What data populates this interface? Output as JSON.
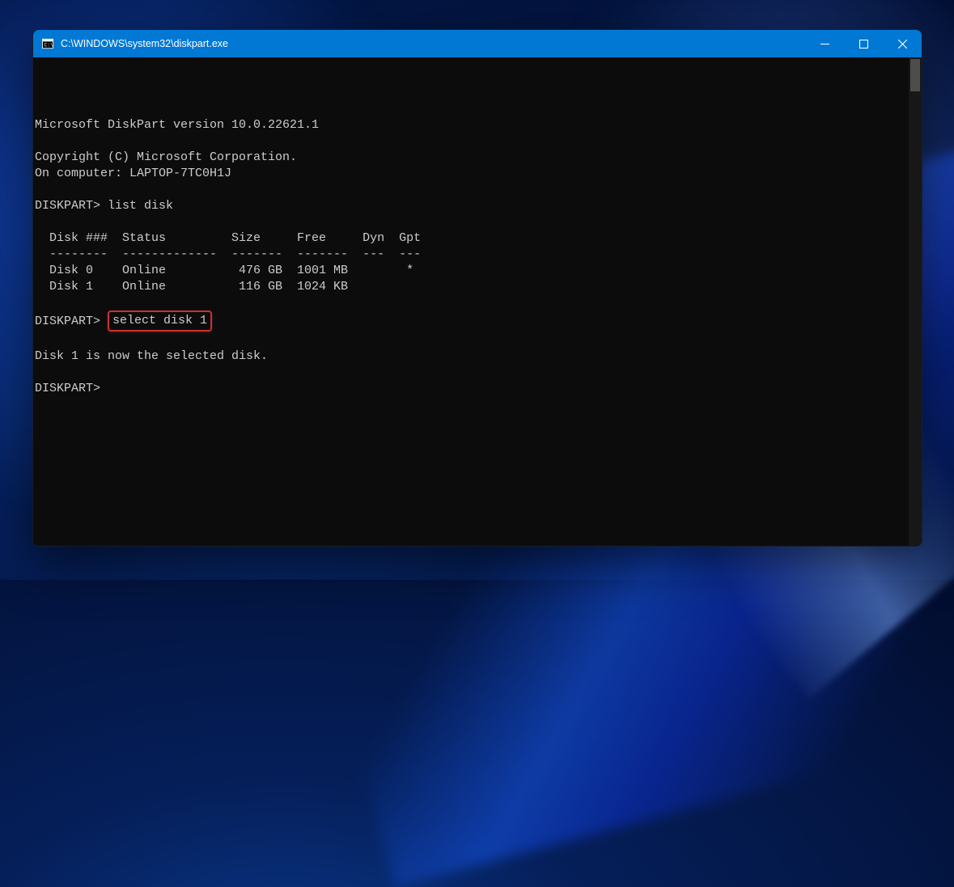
{
  "titlebar": {
    "title": "C:\\WINDOWS\\system32\\diskpart.exe"
  },
  "terminal": {
    "line_version": "Microsoft DiskPart version 10.0.22621.1",
    "line_blank": "",
    "line_copyright": "Copyright (C) Microsoft Corporation.",
    "line_computer": "On computer: LAPTOP-7TC0H1J",
    "prompt1_prefix": "DISKPART> ",
    "prompt1_cmd": "list disk",
    "table_header": "  Disk ###  Status         Size     Free     Dyn  Gpt",
    "table_divider": "  --------  -------------  -------  -------  ---  ---",
    "table_row0": "  Disk 0    Online          476 GB  1001 MB        *",
    "table_row1": "  Disk 1    Online          116 GB  1024 KB",
    "prompt2_prefix": "DISKPART> ",
    "prompt2_cmd": "select disk 1",
    "line_selected": "Disk 1 is now the selected disk.",
    "prompt3": "DISKPART>"
  }
}
